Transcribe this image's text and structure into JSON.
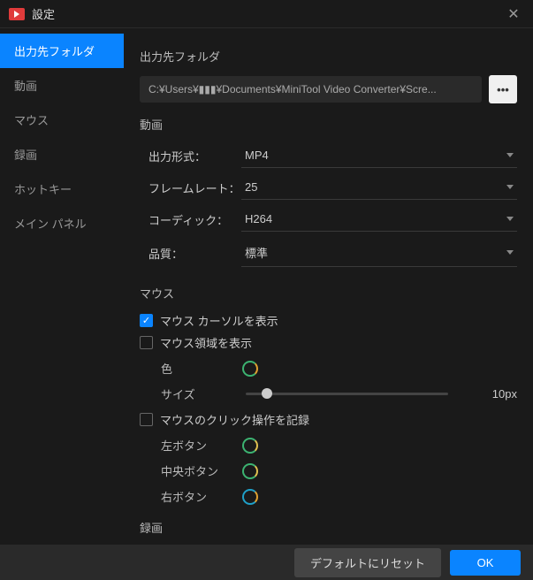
{
  "titlebar": {
    "title": "設定"
  },
  "sidebar": {
    "items": [
      {
        "label": "出力先フォルダ",
        "active": true
      },
      {
        "label": "動画"
      },
      {
        "label": "マウス"
      },
      {
        "label": "録画"
      },
      {
        "label": "ホットキー"
      },
      {
        "label": "メイン パネル"
      }
    ]
  },
  "sections": {
    "output_folder": {
      "title": "出力先フォルダ",
      "path": "C:¥Users¥▮▮▮¥Documents¥MiniTool Video Converter¥Scre..."
    },
    "video": {
      "title": "動画",
      "format_label": "出力形式：",
      "format_value": "MP4",
      "framerate_label": "フレームレート：",
      "framerate_value": "25",
      "codec_label": "コーディック：",
      "codec_value": "H264",
      "quality_label": "品質：",
      "quality_value": "標準"
    },
    "mouse": {
      "title": "マウス",
      "show_cursor": {
        "label": "マウス カーソルを表示",
        "checked": true
      },
      "show_region": {
        "label": "マウス領域を表示",
        "checked": false
      },
      "color_label": "色",
      "size_label": "サイズ",
      "size_value": "10px",
      "record_click": {
        "label": "マウスのクリック操作を記録",
        "checked": false
      },
      "left_label": "左ボタン",
      "middle_label": "中央ボタン",
      "right_label": "右ボタン"
    },
    "record": {
      "title": "録画"
    }
  },
  "footer": {
    "reset": "デフォルトにリセット",
    "ok": "OK"
  }
}
